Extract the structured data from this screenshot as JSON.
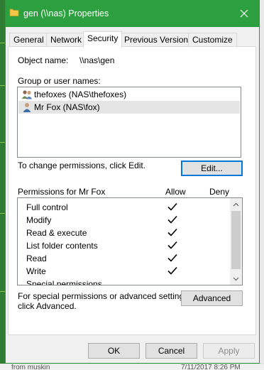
{
  "window": {
    "title": "gen (\\\\nas) Properties",
    "accent": "#2ca03e"
  },
  "tabs": [
    {
      "label": "General",
      "active": false
    },
    {
      "label": "Network",
      "active": false
    },
    {
      "label": "Security",
      "active": true
    },
    {
      "label": "Previous Versions",
      "active": false
    },
    {
      "label": "Customize",
      "active": false
    }
  ],
  "security": {
    "object_name_label": "Object name:",
    "object_name_value": "\\\\nas\\gen",
    "group_label": "Group or user names:",
    "users": [
      {
        "name": "thefoxes (NAS\\thefoxes)",
        "icon": "group-icon",
        "selected": false
      },
      {
        "name": "Mr Fox (NAS\\fox)",
        "icon": "user-icon",
        "selected": true
      }
    ],
    "change_text": "To change permissions, click Edit.",
    "edit_label": "Edit...",
    "permissions_for": "Permissions for Mr Fox",
    "allow_header": "Allow",
    "deny_header": "Deny",
    "permissions": [
      {
        "name": "Full control",
        "allow": true,
        "deny": false
      },
      {
        "name": "Modify",
        "allow": true,
        "deny": false
      },
      {
        "name": "Read & execute",
        "allow": true,
        "deny": false
      },
      {
        "name": "List folder contents",
        "allow": true,
        "deny": false
      },
      {
        "name": "Read",
        "allow": true,
        "deny": false
      },
      {
        "name": "Write",
        "allow": true,
        "deny": false
      },
      {
        "name": "Special permissions",
        "allow": false,
        "deny": false
      }
    ],
    "advanced_text_1": "For special permissions or advanced settings,",
    "advanced_text_2": "click Advanced.",
    "advanced_label": "Advanced"
  },
  "footer": {
    "ok_label": "OK",
    "cancel_label": "Cancel",
    "apply_label": "Apply"
  },
  "background": {
    "left_text": "from muskin",
    "right_text": "7/11/2017 8:26 PM"
  }
}
